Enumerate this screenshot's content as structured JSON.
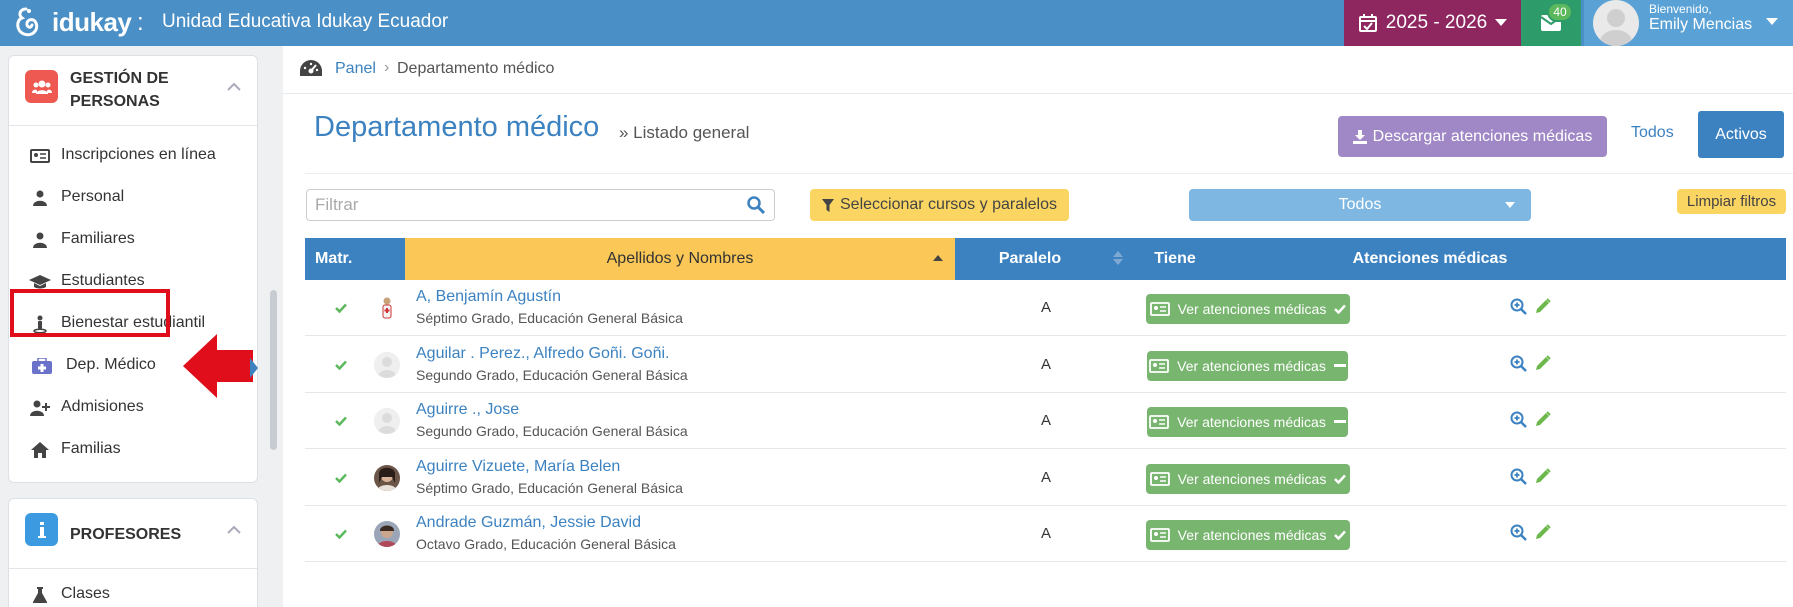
{
  "header": {
    "brand": "idukay",
    "separator": ":",
    "school_name": "Unidad Educativa Idukay Ecuador",
    "school_year": "2025 - 2026",
    "mail_count": "40",
    "welcome": "Bienvenido,",
    "user_name": "Emily Mencias"
  },
  "sidebar": {
    "section1": {
      "title": "GESTIÓN DE PERSONAS",
      "icon": "users-icon",
      "color": "#ee5a52"
    },
    "items": [
      {
        "label": "Inscripciones en línea",
        "icon": "id-card-icon"
      },
      {
        "label": "Personal",
        "icon": "user-icon"
      },
      {
        "label": "Familiares",
        "icon": "user-icon"
      },
      {
        "label": "Estudiantes",
        "icon": "graduation-cap-icon"
      },
      {
        "label": "Bienestar estudiantil",
        "icon": "person-standing-icon"
      },
      {
        "label": "Dep. Médico",
        "icon": "medkit-icon",
        "active": true
      },
      {
        "label": "Admisiones",
        "icon": "user-plus-icon"
      },
      {
        "label": "Familias",
        "icon": "home-icon"
      }
    ],
    "section2": {
      "title": "PROFESORES",
      "icon": "info-icon",
      "color": "#3c9be0"
    },
    "items2": [
      {
        "label": "Clases",
        "icon": "flask-icon"
      }
    ]
  },
  "breadcrumb": {
    "icon": "dashboard-icon",
    "panel": "Panel",
    "separator": "›",
    "current": "Departamento médico"
  },
  "page": {
    "title": "Departamento médico",
    "subtitle": "» Listado general",
    "download_label": "Descargar atenciones médicas",
    "todos_label": "Todos",
    "activos_label": "Activos"
  },
  "filters": {
    "placeholder": "Filtrar",
    "courses_label": "Seleccionar cursos y paralelos",
    "select_value": "Todos",
    "clear_label": "Limpiar filtros"
  },
  "table": {
    "headers": [
      "Matr.",
      "Apellidos y Nombres",
      "Paralelo",
      "Tiene",
      "Atenciones médicas"
    ],
    "view_label": "Ver atenciones médicas",
    "rows": [
      {
        "name": "A, Benjamín Agustín",
        "grade": "Séptimo Grado, Educación General Básica",
        "paralelo": "A",
        "has": true,
        "avatar": "doctor"
      },
      {
        "name": "Aguilar . Perez., Alfredo Goñi. Goñi.",
        "grade": "Segundo Grado, Educación General Básica",
        "paralelo": "A",
        "has": false,
        "avatar": "blank"
      },
      {
        "name": "Aguirre ., Jose",
        "grade": "Segundo Grado, Educación General Básica",
        "paralelo": "A",
        "has": false,
        "avatar": "blank"
      },
      {
        "name": "Aguirre Vizuete, María Belen",
        "grade": "Séptimo Grado, Educación General Básica",
        "paralelo": "A",
        "has": true,
        "avatar": "photo"
      },
      {
        "name": "Andrade Guzmán, Jessie David",
        "grade": "Octavo Grado, Educación General Básica",
        "paralelo": "A",
        "has": true,
        "avatar": "photo2"
      }
    ]
  },
  "colors": {
    "topbar": "#4a8fc6",
    "year": "#8e2760",
    "mail": "#2e9c6a",
    "accent": "#3c82c0",
    "check_green": "#5cb85c",
    "check_pink": "#c0569a",
    "view_button": "#78b56f",
    "highlight_red": "#e00d1a"
  }
}
